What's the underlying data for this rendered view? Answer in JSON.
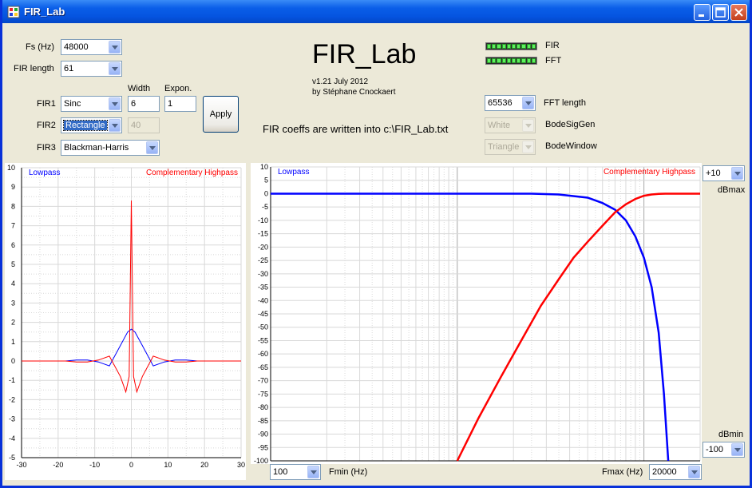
{
  "window": {
    "title": "FIR_Lab"
  },
  "fs": {
    "label": "Fs (Hz)",
    "value": "48000"
  },
  "fir_length": {
    "label": "FIR length",
    "value": "61"
  },
  "headers": {
    "width": "Width",
    "expon": "Expon."
  },
  "fir1": {
    "label": "FIR1",
    "type": "Sinc",
    "width": "6",
    "expon": "1"
  },
  "fir2": {
    "label": "FIR2",
    "type": "Rectangle",
    "width": "40"
  },
  "fir3": {
    "label": "FIR3",
    "type": "Blackman-Harris"
  },
  "apply": "Apply",
  "app": {
    "title": "FIR_Lab",
    "version": "v1.21 July 2012",
    "author": "by Stéphane Cnockaert",
    "coeff_note": "FIR coeffs are written into c:\\FIR_Lab.txt"
  },
  "meters": {
    "fir": "FIR",
    "fft": "FFT"
  },
  "fft_length": {
    "label": "FFT length",
    "value": "65536"
  },
  "bode_sig_gen": {
    "label": "BodeSigGen",
    "value": "White"
  },
  "bode_window": {
    "label": "BodeWindow",
    "value": "Triangle"
  },
  "dbmax": {
    "label": "dBmax",
    "value": "+10"
  },
  "dbmin": {
    "label": "dBmin",
    "value": "-100"
  },
  "fmin": {
    "label": "Fmin (Hz)",
    "value": "100"
  },
  "fmax": {
    "label": "Fmax (Hz)",
    "value": "20000"
  },
  "chart_data": [
    {
      "type": "line",
      "xlim": [
        -30,
        30
      ],
      "ylim": [
        -5,
        10
      ],
      "x_ticks": [
        "-30",
        "-20",
        "-10",
        "0",
        "10",
        "20",
        "30"
      ],
      "y_ticks": [
        "-5",
        "-4",
        "-3",
        "-2",
        "-1",
        "0",
        "1",
        "2",
        "3",
        "4",
        "5",
        "6",
        "7",
        "8",
        "9",
        "10"
      ],
      "grid": true,
      "series": [
        {
          "name": "Lowpass",
          "color": "#0000ff",
          "x": [
            -30,
            -18,
            -15,
            -12,
            -9,
            -6,
            -3,
            -1,
            0,
            1,
            3,
            6,
            9,
            12,
            15,
            18,
            30
          ],
          "y": [
            0,
            0,
            0.05,
            0.05,
            -0.05,
            -0.25,
            0.8,
            1.5,
            1.65,
            1.5,
            0.8,
            -0.25,
            -0.05,
            0.05,
            0.05,
            0,
            0
          ]
        },
        {
          "name": "Complementary Highpass",
          "color": "#ff0000",
          "x": [
            -30,
            -18,
            -15,
            -12,
            -9,
            -6,
            -3,
            -1.5,
            -0.6,
            0,
            0.6,
            1.5,
            3,
            6,
            9,
            12,
            15,
            18,
            30
          ],
          "y": [
            0,
            0,
            -0.05,
            -0.05,
            0.05,
            0.25,
            -0.8,
            -1.6,
            -0.8,
            8.3,
            -0.8,
            -1.6,
            -0.8,
            0.25,
            0.05,
            -0.05,
            -0.05,
            0,
            0
          ]
        }
      ]
    },
    {
      "type": "line",
      "xscale": "log",
      "xlim": [
        100,
        20000
      ],
      "ylim": [
        -100,
        10
      ],
      "y_ticks": [
        "10",
        "5",
        "0",
        "-5",
        "-10",
        "-15",
        "-20",
        "-25",
        "-30",
        "-35",
        "-40",
        "-45",
        "-50",
        "-55",
        "-60",
        "-65",
        "-70",
        "-75",
        "-80",
        "-85",
        "-90",
        "-95",
        "-100"
      ],
      "grid": true,
      "series": [
        {
          "name": "Lowpass",
          "color": "#0000ff",
          "x": [
            100,
            1000,
            2500,
            3500,
            5000,
            6000,
            7000,
            8000,
            9000,
            10000,
            11000,
            12000,
            12800,
            13500
          ],
          "y": [
            0,
            0,
            0,
            -0.3,
            -1.5,
            -3.5,
            -6,
            -10,
            -16,
            -24,
            -35,
            -52,
            -75,
            -100
          ]
        },
        {
          "name": "Complementary Highpass",
          "color": "#ff0000",
          "x": [
            1000,
            1300,
            1700,
            2200,
            2800,
            3500,
            4200,
            5000,
            6000,
            7000,
            8000,
            9000,
            10000,
            11000,
            12000,
            13000,
            20000
          ],
          "y": [
            -100,
            -84,
            -69,
            -55,
            -42,
            -32,
            -24,
            -18,
            -12,
            -7,
            -4,
            -2,
            -0.8,
            -0.3,
            -0.1,
            0,
            0
          ]
        }
      ]
    }
  ]
}
